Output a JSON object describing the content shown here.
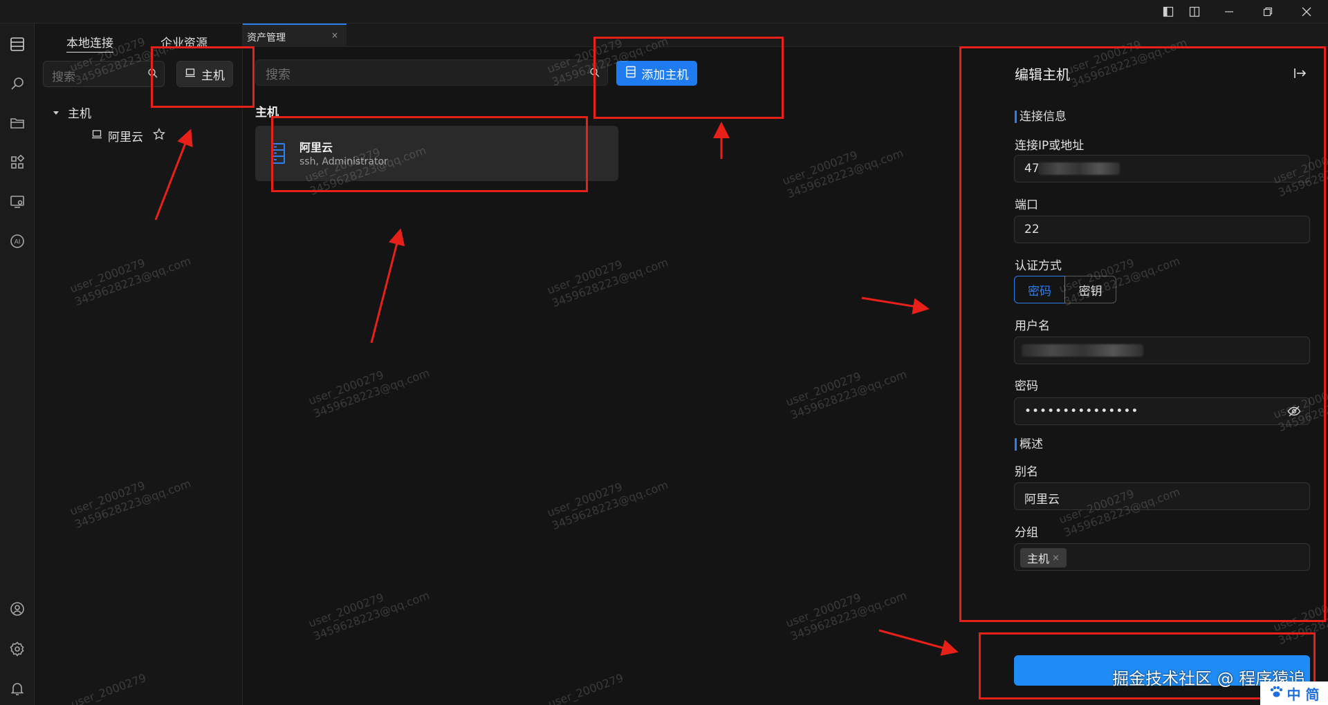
{
  "window_controls": {
    "layout_left": "▮",
    "layout_split": "◫",
    "minimize": "—",
    "maximize": "❐",
    "close": "✕"
  },
  "activity_bar": [
    "assets-icon",
    "search-icon",
    "folder-icon",
    "apps-icon",
    "monitor-icon",
    "ai-icon",
    "user-icon",
    "settings-icon",
    "bell-icon"
  ],
  "ai_label": "AI",
  "sidebar": {
    "tabs": [
      "本地连接",
      "企业资源"
    ],
    "search_placeholder": "搜索",
    "host_button": "主机",
    "tree": {
      "group": "主机",
      "items": [
        {
          "label": "阿里云"
        }
      ]
    }
  },
  "tabs": [
    {
      "label": "资产管理",
      "close": "×"
    }
  ],
  "main": {
    "search_placeholder": "搜索",
    "add_button": "添加主机",
    "section_title": "主机",
    "host_card": {
      "name": "阿里云",
      "sub": "ssh, Administrator"
    }
  },
  "edit_panel": {
    "title": "编辑主机",
    "connection_head": "连接信息",
    "ip_label": "连接IP或地址",
    "ip_value_visible": "47",
    "port_label": "端口",
    "port_value": "22",
    "auth_label": "认证方式",
    "auth_options": [
      "密码",
      "密钥"
    ],
    "auth_selected": "密码",
    "username_label": "用户名",
    "password_label": "密码",
    "password_mask": "•••••••••••••••",
    "overview_head": "概述",
    "alias_label": "别名",
    "alias_value": "阿里云",
    "group_label": "分组",
    "group_tag": "主机",
    "group_tag_remove": "×"
  },
  "watermark": {
    "user": "user_2000279",
    "email": "3459628223@qq.com"
  },
  "corner_watermark": "掘金技术社区 @ 程序猿追",
  "corner_badge": "中 简",
  "colors": {
    "accent": "#1f7cf0",
    "annotation": "#e8201a",
    "background": "#141414"
  }
}
